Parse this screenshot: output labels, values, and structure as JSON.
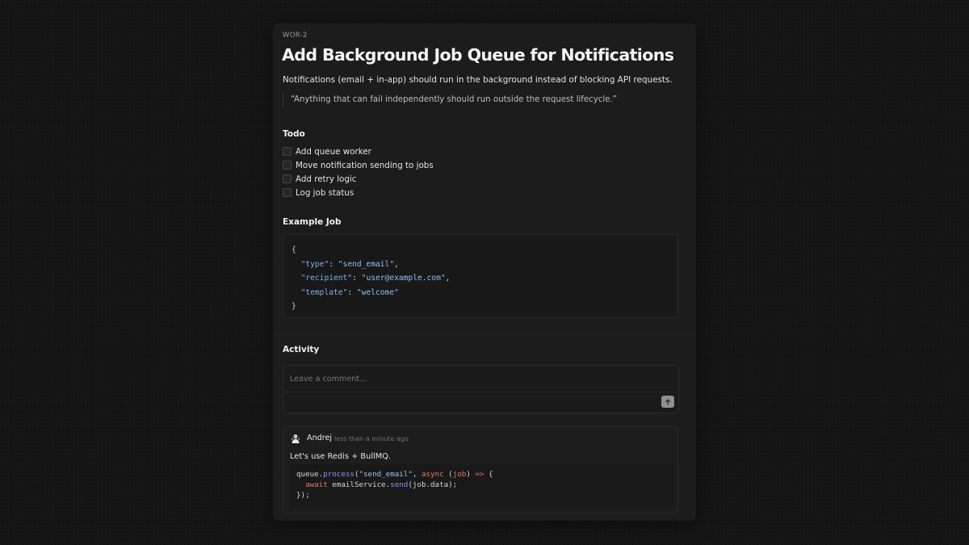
{
  "issue": {
    "id": "WOR-2",
    "title": "Add Background Job Queue for Notifications",
    "description": "Notifications (email + in-app) should run in the background instead of blocking API requests.",
    "quote": "“Anything that can fail independently should run outside the request lifecycle.”"
  },
  "todo": {
    "heading": "Todo",
    "items": [
      {
        "label": "Add queue worker",
        "checked": false
      },
      {
        "label": "Move notification sending to jobs",
        "checked": false
      },
      {
        "label": "Add retry logic",
        "checked": false
      },
      {
        "label": "Log job status",
        "checked": false
      }
    ]
  },
  "example_job": {
    "heading": "Example Job",
    "open_brace": "{",
    "close_brace": "}",
    "fields": [
      {
        "key": "\"type\"",
        "value": "\"send_email\""
      },
      {
        "key": "\"recipient\"",
        "value": "\"user@example.com\""
      },
      {
        "key": "\"template\"",
        "value": "\"welcome\""
      }
    ]
  },
  "activity": {
    "heading": "Activity",
    "comment_placeholder": "Leave a comment...",
    "submit_icon": "arrow-up-icon",
    "comments": [
      {
        "author": "Andrej",
        "timestamp": "less than a minute ago",
        "text": "Let's use Redis + BullMQ.",
        "code": {
          "l1_obj": "queue.",
          "l1_fn": "process",
          "l1_paren_open": "(",
          "l1_str": "\"send_email\"",
          "l1_comma": ", ",
          "l1_async": "async",
          "l1_params_open": " (",
          "l1_param": "job",
          "l1_params_close": ") ",
          "l1_arrow": "=>",
          "l1_brace": " {",
          "l2_indent": "  ",
          "l2_await": "await",
          "l2_obj": " emailService.",
          "l2_fn": "send",
          "l2_args": "(job.data);",
          "l3": "});"
        }
      }
    ]
  },
  "colors": {
    "background": "#141414",
    "panel": "#1c1c1c",
    "code_key": "#7db0e8",
    "code_function": "#8f8ff5",
    "code_keyword": "#e07a5a",
    "submit_button": "#8f8f8f"
  }
}
